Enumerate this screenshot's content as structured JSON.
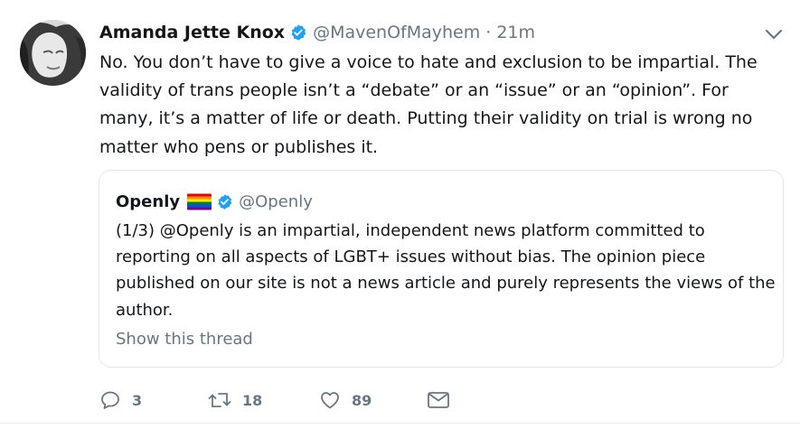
{
  "tweet": {
    "author": {
      "name": "Amanda Jette Knox",
      "handle": "@MavenOfMayhem",
      "separator": "·",
      "time": "21m",
      "verified": true
    },
    "text": "No. You don’t have to give a voice to hate and exclusion to be impartial. The validity of trans people isn’t a “debate” or an “issue” or an “opinion”. For many, it’s a matter of life or death. Putting their validity on trial is wrong no matter who pens or publishes it.",
    "quoted": {
      "name": "Openly",
      "handle": "@Openly",
      "verified": true,
      "flag_icon": "rainbow-flag-emoji",
      "text": "(1/3) @Openly is an impartial, independent news platform committed to reporting on all aspects of LGBT+ issues without bias. The opinion piece published on our site is not a news article and purely represents the views of the author.",
      "show_thread_label": "Show this thread"
    },
    "actions": {
      "reply_count": "3",
      "retweet_count": "18",
      "like_count": "89"
    }
  },
  "colors": {
    "text_primary": "#14171a",
    "text_secondary": "#657786",
    "verified_blue": "#1da1f2",
    "border": "#e1e8ed"
  }
}
